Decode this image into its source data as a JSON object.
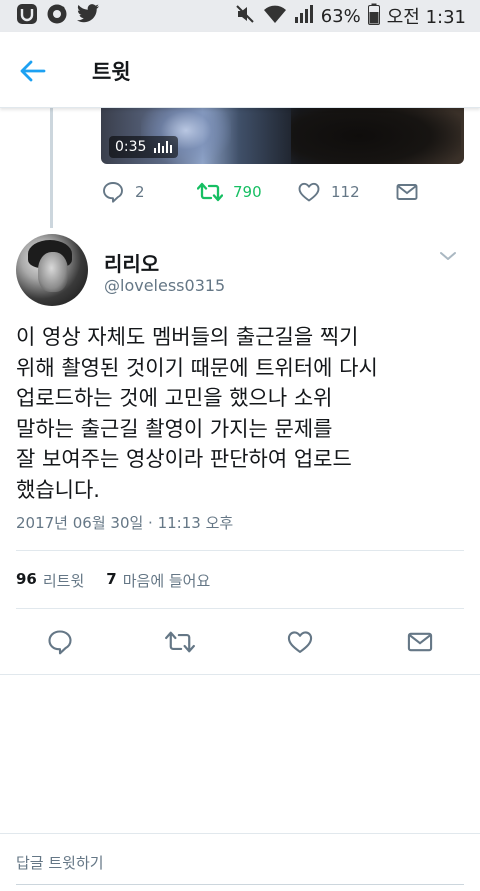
{
  "status_bar": {
    "battery_percent": "63%",
    "time": "오전 1:31",
    "icons": [
      "app-icon",
      "camera-icon",
      "twitter-bird-icon",
      "mute-icon",
      "wifi-icon",
      "signal-icon",
      "battery-icon"
    ]
  },
  "header": {
    "title": "트윗"
  },
  "previous_tweet": {
    "video_duration": "0:35",
    "reply_count": "2",
    "retweet_count": "790",
    "like_count": "112"
  },
  "tweet": {
    "display_name": "리리오",
    "handle": "@loveless0315",
    "text": "이 영상 자체도 멤버들의 출근길을 찍기\n위해 촬영된 것이기 때문에 트위터에 다시\n업로드하는 것에 고민을 했으나 소위\n말하는 출근길 촬영이 가지는 문제를\n잘 보여주는 영상이라 판단하여 업로드\n했습니다.",
    "timestamp": "2017년 06월 30일 · 11:13 오후",
    "stats": {
      "retweets_count": "96",
      "retweets_label": "리트윗",
      "likes_count": "7",
      "likes_label": "마음에 들어요"
    }
  },
  "reply_bar": {
    "placeholder": "답글 트윗하기"
  },
  "colors": {
    "accent": "#1da1f2",
    "retweet_green": "#17bf63",
    "secondary_text": "#657786"
  }
}
